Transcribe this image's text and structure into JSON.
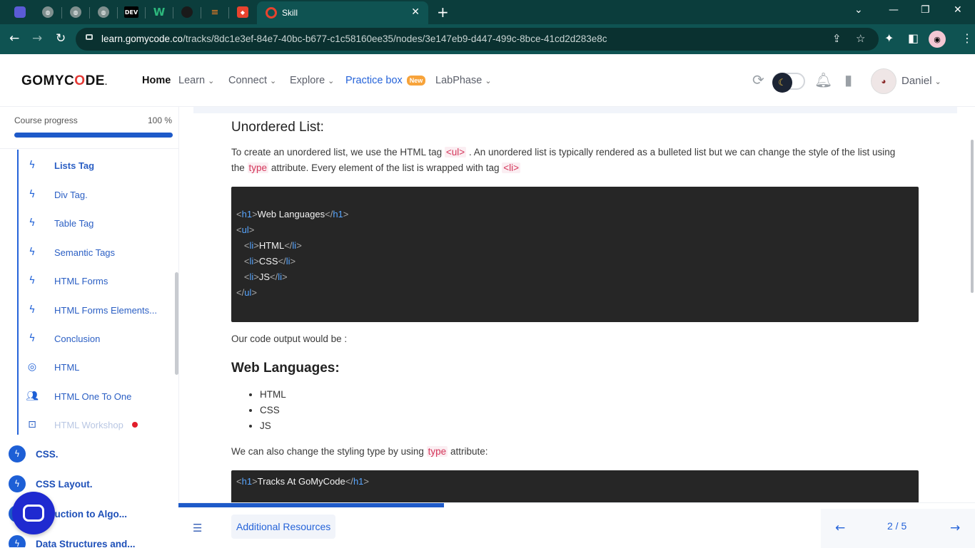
{
  "browser": {
    "active_tab_title": "Skill",
    "url_host": "learn.gomycode.co",
    "url_path": "/tracks/8dc1e3ef-84e7-40bc-b677-c1c58160ee35/nodes/3e147eb9-d447-499c-8bce-41cd2d283e8c",
    "pinned_tab_labels": [
      "DEV",
      "W"
    ]
  },
  "header": {
    "logo_prefix": "GOMYC",
    "logo_o": "O",
    "logo_suffix": "DE",
    "logo_dot": ".",
    "nav": {
      "home": "Home",
      "learn": "Learn",
      "connect": "Connect",
      "explore": "Explore",
      "practice": "Practice box",
      "practice_badge": "New",
      "labphase": "LabPhase"
    },
    "username": "Daniel"
  },
  "sidebar": {
    "progress_label": "Course progress",
    "progress_value": "100 %",
    "progress_fraction": 1.0,
    "lessons": [
      {
        "label": "Lists Tag",
        "icon": "lightning-icon"
      },
      {
        "label": "Div Tag.",
        "icon": "lightning-icon"
      },
      {
        "label": "Table Tag",
        "icon": "lightning-icon"
      },
      {
        "label": "Semantic Tags",
        "icon": "lightning-icon"
      },
      {
        "label": "HTML Forms",
        "icon": "lightning-icon"
      },
      {
        "label": "HTML Forms Elements...",
        "icon": "lightning-icon"
      },
      {
        "label": "Conclusion",
        "icon": "lightning-icon"
      },
      {
        "label": "HTML",
        "icon": "target-icon"
      },
      {
        "label": "HTML One To One",
        "icon": "people-icon"
      },
      {
        "label": "HTML Workshop",
        "icon": "workshop-icon"
      }
    ],
    "modules": [
      {
        "label": "CSS."
      },
      {
        "label": "CSS Layout."
      },
      {
        "label": "oduction to Algo..."
      },
      {
        "label": "Data Structures and..."
      }
    ]
  },
  "content": {
    "heading_unordered": "Unordered List:",
    "intro_1": "To create an unordered list, we use the HTML tag ",
    "intro_ul": "<ul>",
    "intro_2": " . An unordered list is typically rendered as a bulleted list but we can change the style of the list using",
    "intro_3": "the ",
    "intro_type": "type",
    "intro_4": " attribute. Every element of the list is wrapped with tag ",
    "intro_li": "<li>",
    "code1": {
      "h1_open": "h1",
      "h1_text": "Web Languages",
      "ul": "ul",
      "li": "li",
      "items": [
        "HTML",
        "CSS",
        "JS"
      ]
    },
    "output_label": "Our code output would be :",
    "heading_web": "Web Languages:",
    "bullets": [
      "HTML",
      "CSS",
      "JS"
    ],
    "styling_1": "We can also change the styling type by using ",
    "styling_type": "type",
    "styling_2": " attribute:",
    "code2": {
      "h1": "h1",
      "text": "Tracks At GoMyCode"
    }
  },
  "bottom": {
    "additional_resources": "Additional Resources",
    "pager": "2 / 5",
    "progress_fraction": 0.333
  }
}
